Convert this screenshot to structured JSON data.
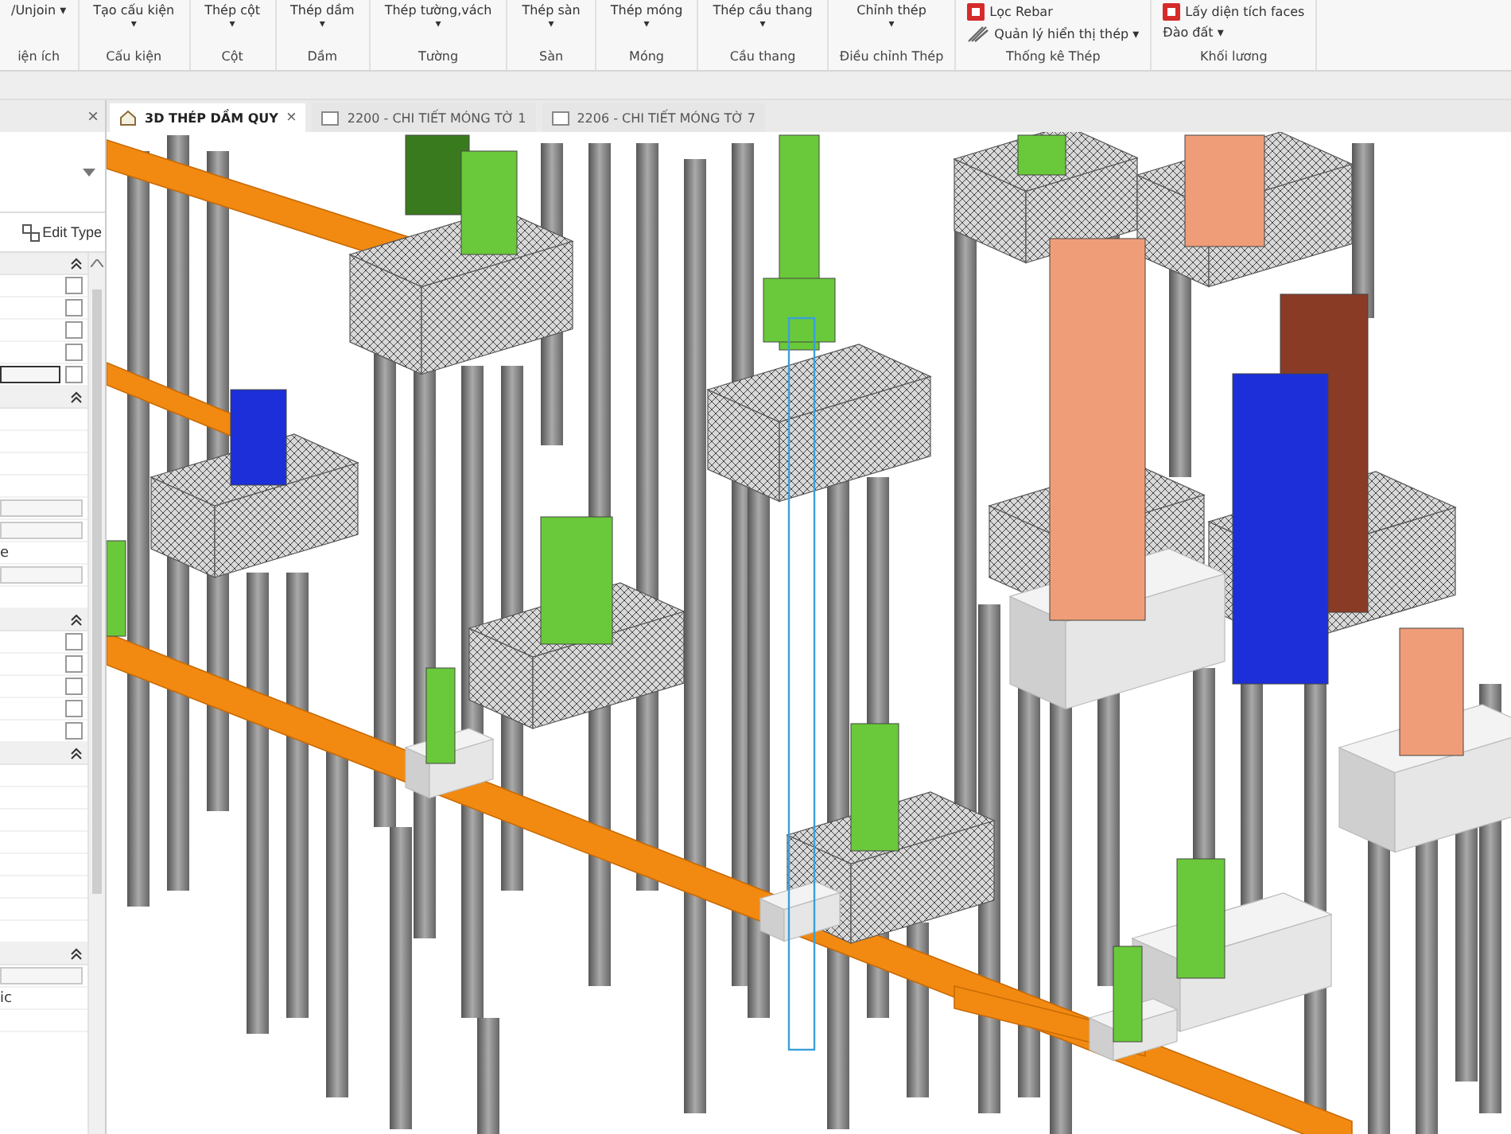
{
  "ribbon": {
    "utility": {
      "items": [
        "/Unjoin ▾"
      ],
      "label": "iện ích"
    },
    "groups": [
      {
        "button": "Tạo cấu kiện",
        "label": "Cấu kiện"
      },
      {
        "button": "Thép cột",
        "label": "Cột"
      },
      {
        "button": "Thép dầm",
        "label": "Dầm"
      },
      {
        "button": "Thép tường,vách",
        "label": "Tường"
      },
      {
        "button": "Thép sàn",
        "label": "Sàn"
      },
      {
        "button": "Thép móng",
        "label": "Móng"
      },
      {
        "button": "Thép cầu thang",
        "label": "Cầu thang"
      },
      {
        "button": "Chỉnh thép",
        "label": "Điều chỉnh Thép"
      }
    ],
    "panels": [
      {
        "items": [
          {
            "text": "Lọc Rebar",
            "kind": "rebar"
          },
          {
            "text": "Quản lý hiển thị thép ▾",
            "kind": "display"
          }
        ],
        "label": "Thống kê Thép"
      },
      {
        "items": [
          {
            "text": "Lấy diện tích faces",
            "kind": "faces"
          },
          {
            "text": "Đào đất ▾",
            "kind": "plain"
          }
        ],
        "label": "Khối lương"
      }
    ]
  },
  "properties": {
    "edit_type": "Edit Type",
    "sections": [
      {
        "rows": [
          {
            "kind": "checkbox",
            "checked": false
          },
          {
            "kind": "checkbox",
            "checked": false
          },
          {
            "kind": "checkbox",
            "checked": false
          },
          {
            "kind": "checkbox",
            "checked": false
          },
          {
            "kind": "field-checkbox",
            "checked": false
          }
        ]
      },
      {
        "rows": [
          {
            "kind": "empty"
          },
          {
            "kind": "empty"
          },
          {
            "kind": "empty"
          },
          {
            "kind": "empty"
          },
          {
            "kind": "field"
          },
          {
            "kind": "field"
          },
          {
            "kind": "text",
            "text": "e"
          },
          {
            "kind": "field"
          },
          {
            "kind": "empty"
          }
        ]
      },
      {
        "rows": [
          {
            "kind": "checkbox",
            "checked": false
          },
          {
            "kind": "checkbox",
            "checked": false
          },
          {
            "kind": "checkbox",
            "checked": false
          },
          {
            "kind": "checkbox",
            "checked": false
          },
          {
            "kind": "checkbox",
            "checked": false
          }
        ]
      },
      {
        "rows": [
          {
            "kind": "empty"
          },
          {
            "kind": "empty"
          },
          {
            "kind": "empty"
          },
          {
            "kind": "empty"
          },
          {
            "kind": "empty"
          },
          {
            "kind": "empty"
          },
          {
            "kind": "empty"
          },
          {
            "kind": "empty"
          }
        ]
      },
      {
        "rows": [
          {
            "kind": "field"
          },
          {
            "kind": "text",
            "text": "ic"
          },
          {
            "kind": "empty"
          }
        ]
      }
    ]
  },
  "tabs": [
    {
      "label": "3D THÉP DẦM QUY",
      "selected": true,
      "kind": "model"
    },
    {
      "label": "2200 - CHI TIẾT MÓNG TỜ 1",
      "selected": false,
      "kind": "sheet"
    },
    {
      "label": "2206 - CHI TIẾT MÓNG TỜ 7",
      "selected": false,
      "kind": "sheet"
    }
  ],
  "close_symbol": "×",
  "caret": "▾"
}
